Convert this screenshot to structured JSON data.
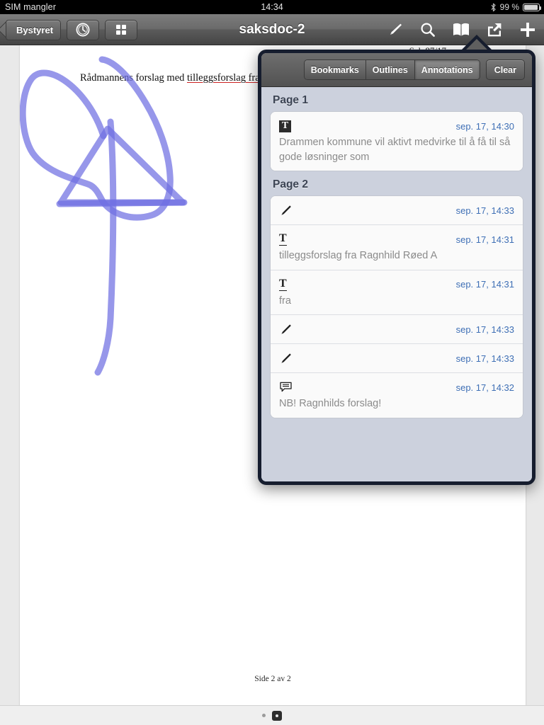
{
  "statusbar": {
    "carrier": "SIM mangler",
    "time": "14:34",
    "battery_percent": "99 %",
    "bluetooth_icon": "bluetooth-icon",
    "battery_icon": "battery-icon"
  },
  "toolbar": {
    "back_label": "Bystyret",
    "title": "saksdoc-2",
    "buttons": [
      {
        "name": "back-button",
        "label": "Bystyret"
      },
      {
        "name": "recents-clock-button",
        "icon": "clock-icon"
      },
      {
        "name": "thumbnails-grid-button",
        "icon": "grid-icon"
      }
    ],
    "right_buttons": [
      {
        "name": "annotate-pencil-button",
        "icon": "marker-pen-icon"
      },
      {
        "name": "search-button",
        "icon": "search-icon"
      },
      {
        "name": "bookmarks-button",
        "icon": "book-icon"
      },
      {
        "name": "share-button",
        "icon": "share-icon"
      },
      {
        "name": "add-button",
        "icon": "plus-icon"
      }
    ]
  },
  "document": {
    "heading_prefix": "Rådmannens forslag med ",
    "heading_underlined": "tilleggsforslag fra",
    "sak_label": "Sak 87/17",
    "footer": "Side 2 av 2",
    "ink_color": "#6f6fe2"
  },
  "bottombar": {
    "page_dots": [
      {
        "name": "page-dot-1",
        "current": false
      },
      {
        "name": "page-dot-2",
        "current": true
      }
    ]
  },
  "popover": {
    "tabs": [
      {
        "label": "Bookmarks",
        "active": false
      },
      {
        "label": "Outlines",
        "active": false
      },
      {
        "label": "Annotations",
        "active": true
      }
    ],
    "clear_label": "Clear",
    "sections": [
      {
        "title": "Page 1",
        "rows": [
          {
            "icon": "text-highlight-icon",
            "icon_kind": "highlight",
            "date": "sep. 17, 14:30",
            "text": "Drammen kommune vil aktivt medvirke til å få til så gode løsninger som"
          }
        ]
      },
      {
        "title": "Page 2",
        "rows": [
          {
            "icon": "ink-pencil-icon",
            "icon_kind": "pencil",
            "date": "sep. 17, 14:33",
            "text": ""
          },
          {
            "icon": "text-underline-icon",
            "icon_kind": "underline",
            "date": "sep. 17, 14:31",
            "text": "tilleggsforslag fra Ragnhild Røed A"
          },
          {
            "icon": "text-underline-icon",
            "icon_kind": "underline",
            "date": "sep. 17, 14:31",
            "text": "fra"
          },
          {
            "icon": "ink-pencil-icon",
            "icon_kind": "pencil",
            "date": "sep. 17, 14:33",
            "text": ""
          },
          {
            "icon": "ink-pencil-icon",
            "icon_kind": "pencil",
            "date": "sep. 17, 14:33",
            "text": ""
          },
          {
            "icon": "note-comment-icon",
            "icon_kind": "note",
            "date": "sep. 17, 14:32",
            "text": "NB! Ragnhilds forslag!"
          }
        ]
      }
    ]
  },
  "colors": {
    "date_blue": "#3e6fb5",
    "popover_bg": "#ccd1dd",
    "popover_border": "#161d2e",
    "toolbar_gray": "#5f5f5f",
    "underline_red": "#cc2222"
  }
}
